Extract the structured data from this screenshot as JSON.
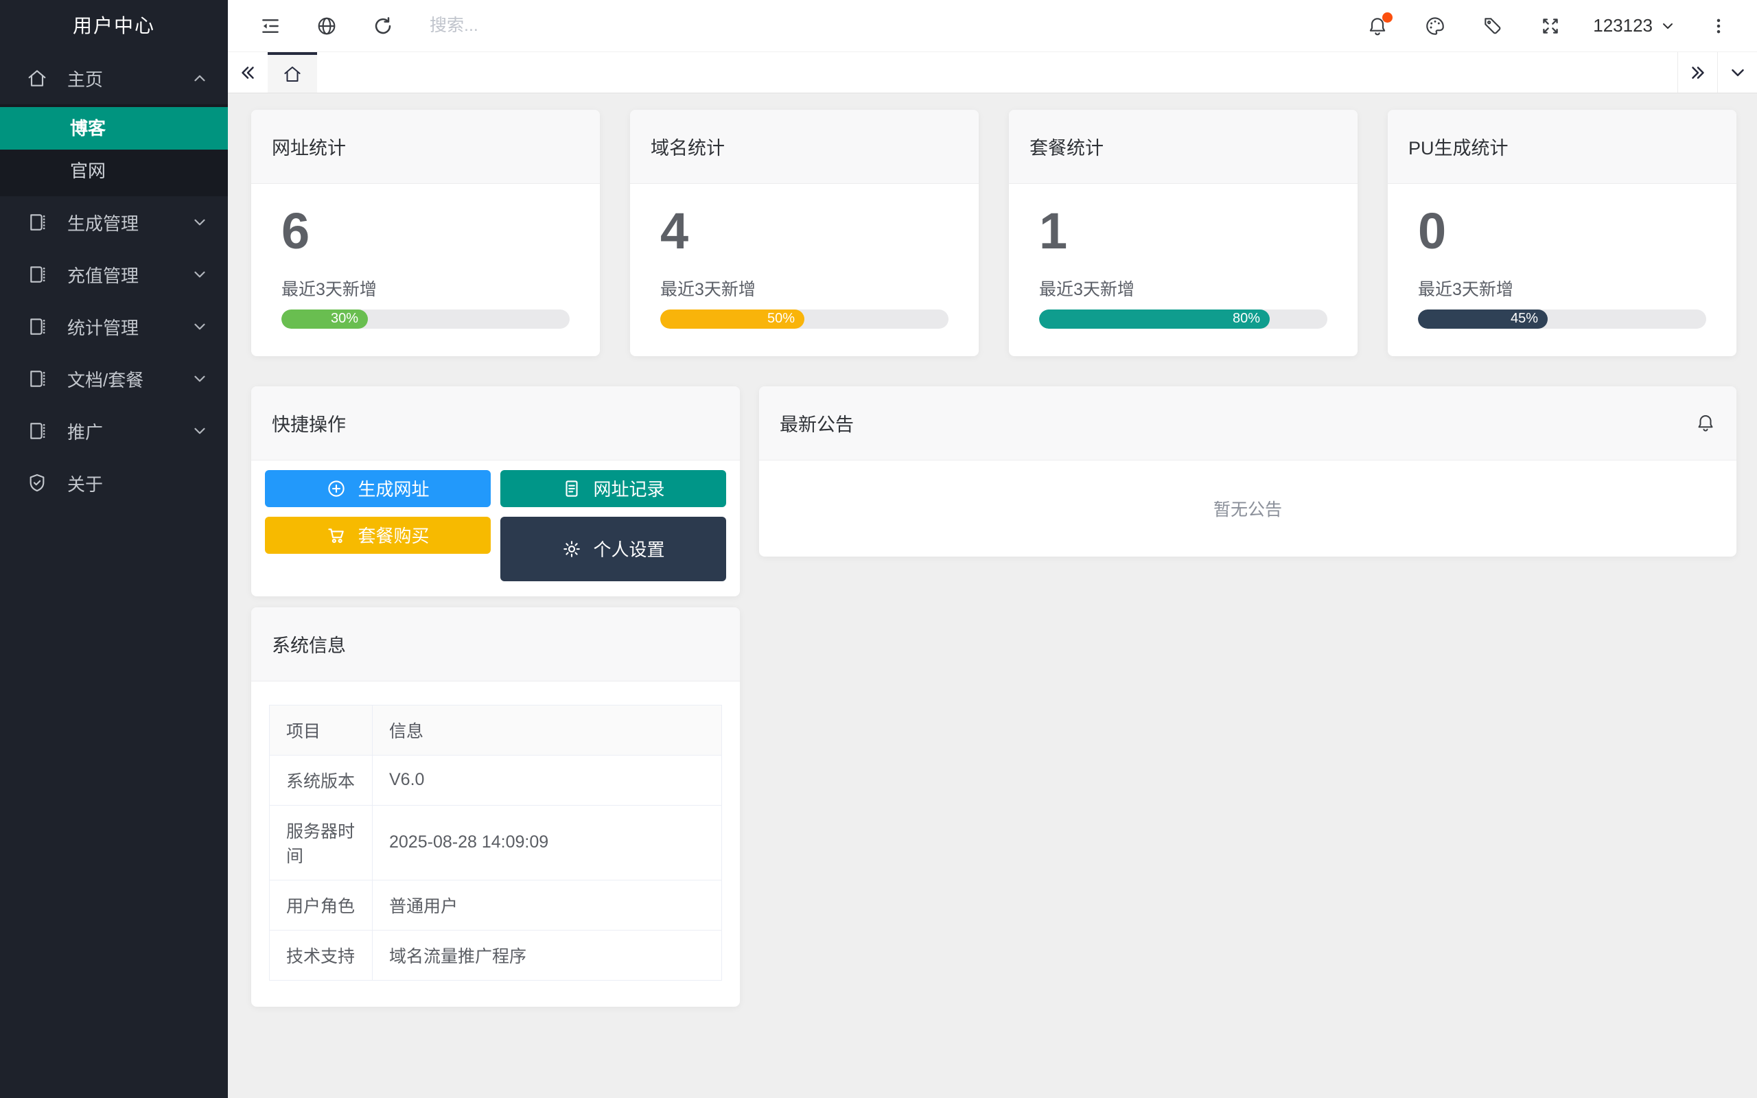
{
  "sidebar": {
    "title": "用户中心",
    "items": [
      {
        "label": "主页"
      },
      {
        "label": "博客"
      },
      {
        "label": "官网"
      },
      {
        "label": "生成管理"
      },
      {
        "label": "充值管理"
      },
      {
        "label": "统计管理"
      },
      {
        "label": "文档/套餐"
      },
      {
        "label": "推广"
      },
      {
        "label": "关于"
      }
    ]
  },
  "header": {
    "search_placeholder": "搜索...",
    "username": "123123"
  },
  "colors": {
    "sidebar_active": "#00947f",
    "notification_badge": "#fb4f0e"
  },
  "stats": [
    {
      "title": "网址统计",
      "value": "6",
      "recent_label": "最近3天新增",
      "percent": 30,
      "percent_text": "30%",
      "color": "#69be50"
    },
    {
      "title": "域名统计",
      "value": "4",
      "recent_label": "最近3天新增",
      "percent": 50,
      "percent_text": "50%",
      "color": "#f9b40a"
    },
    {
      "title": "套餐统计",
      "value": "1",
      "recent_label": "最近3天新增",
      "percent": 80,
      "percent_text": "80%",
      "color": "#0f9d8e"
    },
    {
      "title": "PU生成统计",
      "value": "0",
      "recent_label": "最近3天新增",
      "percent": 45,
      "percent_text": "45%",
      "color": "#2f4156"
    }
  ],
  "quick_actions": {
    "title": "快捷操作",
    "buttons": [
      {
        "label": "生成网址",
        "color": "#2299fb",
        "icon": "circle-plus-icon"
      },
      {
        "label": "网址记录",
        "color": "#009688",
        "icon": "document-icon"
      },
      {
        "label": "套餐购买",
        "color": "#f7ba00",
        "icon": "cart-icon"
      },
      {
        "label": "个人设置",
        "color": "#2c3a4e",
        "icon": "gear-icon"
      }
    ]
  },
  "announcements": {
    "title": "最新公告",
    "empty_text": "暂无公告"
  },
  "system_info": {
    "title": "系统信息",
    "columns": [
      "项目",
      "信息"
    ],
    "rows": [
      [
        "系统版本",
        "V6.0"
      ],
      [
        "服务器时间",
        "2025-08-28 14:09:09"
      ],
      [
        "用户角色",
        "普通用户"
      ],
      [
        "技术支持",
        "域名流量推广程序"
      ]
    ]
  }
}
